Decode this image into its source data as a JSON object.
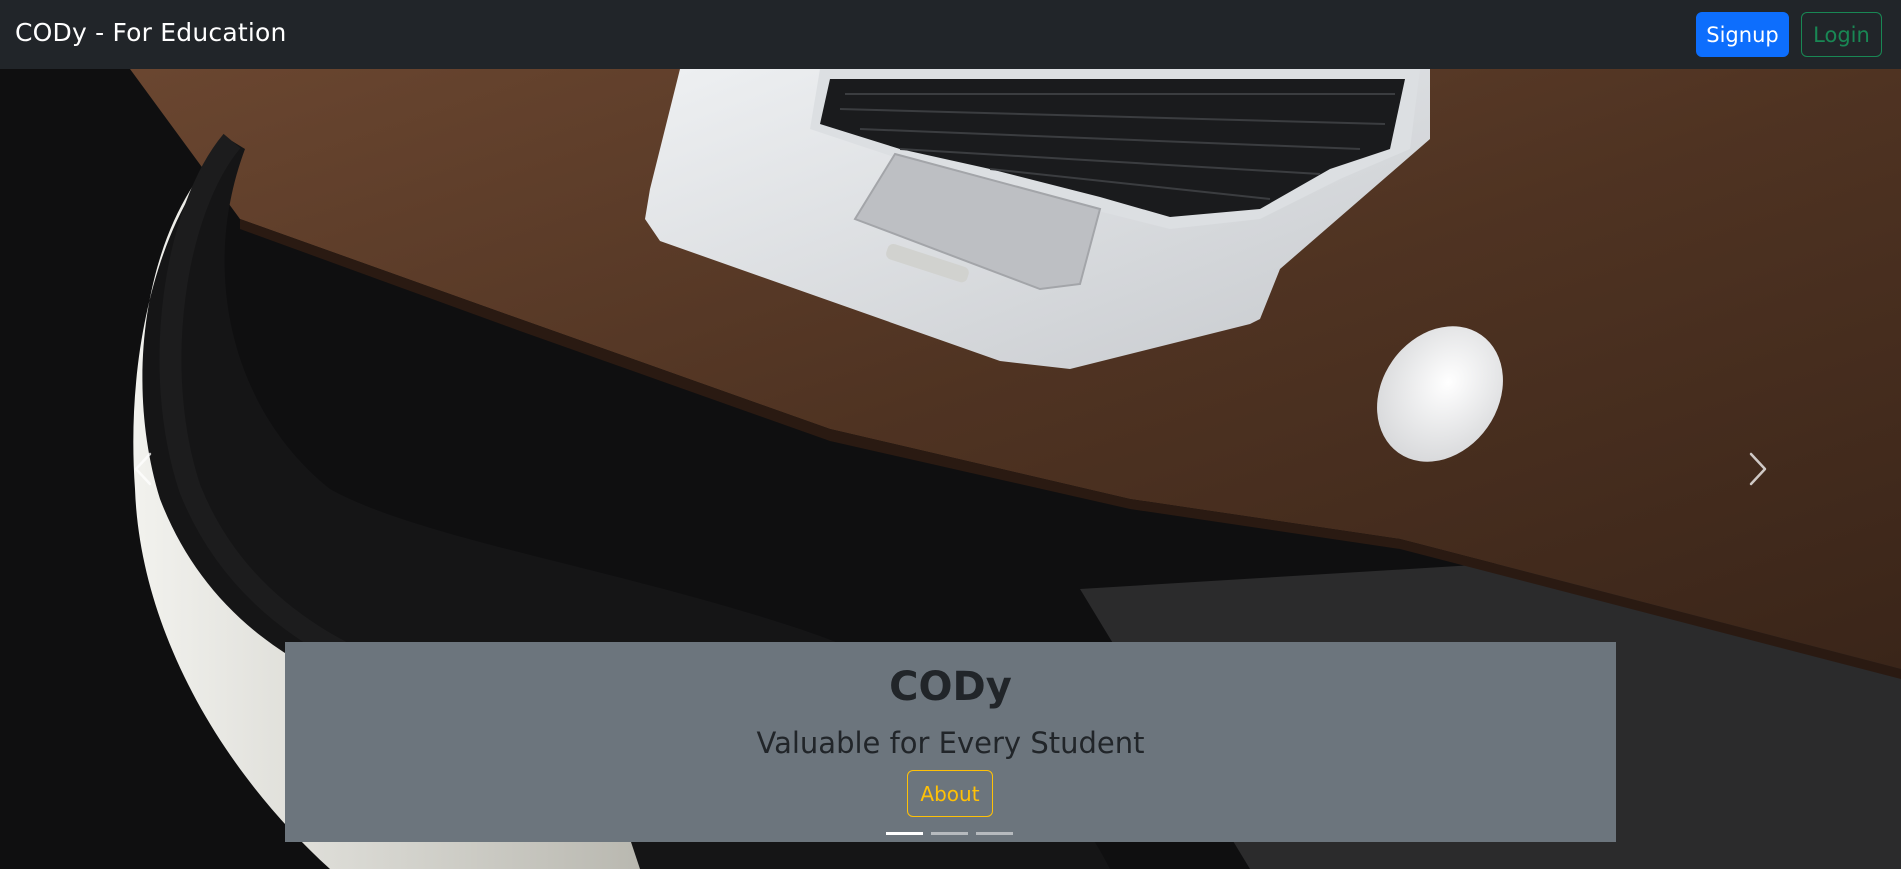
{
  "navbar": {
    "brand": "CODy - For Education",
    "signup_label": "Signup",
    "login_label": "Login"
  },
  "carousel": {
    "caption_title": "CODy",
    "caption_subtitle": "Valuable for Every Student",
    "about_label": "About",
    "active_slide": 1,
    "slide_count": 3
  },
  "colors": {
    "navbar_bg": "#212529",
    "signup_bg": "#0d6efd",
    "login_outline": "#198754",
    "about_outline": "#ffc107",
    "caption_bg": "#6c757d"
  },
  "icons": [
    "chevron-left-icon",
    "chevron-right-icon"
  ]
}
